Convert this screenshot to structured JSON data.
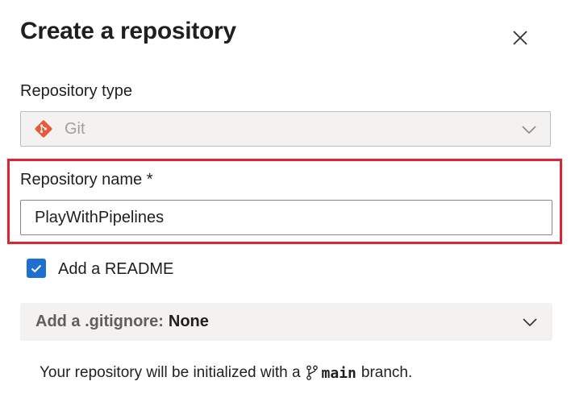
{
  "dialog": {
    "title": "Create a repository"
  },
  "repo_type": {
    "label": "Repository type",
    "value": "Git",
    "icon": "git-icon",
    "brand_color": "#e8593b"
  },
  "repo_name": {
    "label": "Repository name *",
    "value": "PlayWithPipelines"
  },
  "readme": {
    "label": "Add a README",
    "checked": true
  },
  "gitignore": {
    "label": "Add a .gitignore:",
    "value": "None"
  },
  "info": {
    "prefix": "Your repository will be initialized with a",
    "branch": "main",
    "suffix": "branch."
  },
  "colors": {
    "highlight": "#e0232e",
    "checkbox": "#1f6fd1"
  }
}
